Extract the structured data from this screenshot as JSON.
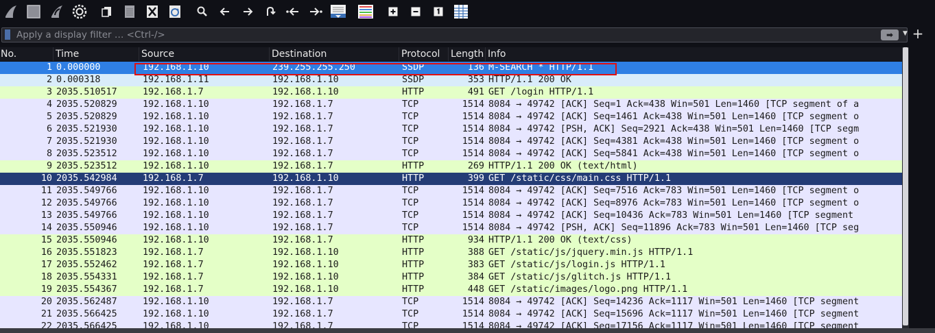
{
  "toolbar": {
    "icons": [
      "shark-fin-start-icon",
      "stop-capture-icon",
      "shark-fin-restart-icon",
      "capture-options-gear-icon",
      "open-file-icon",
      "save-file-icon",
      "close-file-icon",
      "reload-file-icon",
      "find-packet-icon",
      "go-back-icon",
      "go-forward-icon",
      "go-to-packet-icon",
      "first-packet-icon",
      "last-packet-icon",
      "auto-scroll-icon",
      "colorize-icon",
      "zoom-in-icon",
      "zoom-out-icon",
      "normal-size-icon",
      "resize-columns-icon"
    ]
  },
  "filter": {
    "placeholder": "Apply a display filter … <Ctrl-/>",
    "apply_glyph": "➡",
    "dropdown_glyph": "▼",
    "add_glyph": "+"
  },
  "columns": [
    "No.",
    "Time",
    "Source",
    "Destination",
    "Protocol",
    "Length",
    "Info"
  ],
  "colors": {
    "udp": "#d9ecfa",
    "http": "#e4ffc7",
    "tcp": "#e7e6ff",
    "selected": "#2f7fe4",
    "selected_dark": "#243c76",
    "highlight_box": "#e01010"
  },
  "packets": [
    {
      "no": "1",
      "time": "0.000000",
      "src": "192.168.1.10",
      "dst": "239.255.255.250",
      "proto": "SSDP",
      "len": "136",
      "info": "M-SEARCH * HTTP/1.1",
      "style": "selected"
    },
    {
      "no": "2",
      "time": "0.000318",
      "src": "192.168.1.11",
      "dst": "192.168.1.10",
      "proto": "SSDP",
      "len": "353",
      "info": "HTTP/1.1 200 OK",
      "style": "udp"
    },
    {
      "no": "3",
      "time": "2035.510517",
      "src": "192.168.1.7",
      "dst": "192.168.1.10",
      "proto": "HTTP",
      "len": "491",
      "info": "GET /login HTTP/1.1",
      "style": "http"
    },
    {
      "no": "4",
      "time": "2035.520829",
      "src": "192.168.1.10",
      "dst": "192.168.1.7",
      "proto": "TCP",
      "len": "1514",
      "info": "8084 → 49742 [ACK] Seq=1 Ack=438 Win=501 Len=1460 [TCP segment of a",
      "style": "tcp"
    },
    {
      "no": "5",
      "time": "2035.520829",
      "src": "192.168.1.10",
      "dst": "192.168.1.7",
      "proto": "TCP",
      "len": "1514",
      "info": "8084 → 49742 [ACK] Seq=1461 Ack=438 Win=501 Len=1460 [TCP segment o",
      "style": "tcp"
    },
    {
      "no": "6",
      "time": "2035.521930",
      "src": "192.168.1.10",
      "dst": "192.168.1.7",
      "proto": "TCP",
      "len": "1514",
      "info": "8084 → 49742 [PSH, ACK] Seq=2921 Ack=438 Win=501 Len=1460 [TCP segm",
      "style": "tcp"
    },
    {
      "no": "7",
      "time": "2035.521930",
      "src": "192.168.1.10",
      "dst": "192.168.1.7",
      "proto": "TCP",
      "len": "1514",
      "info": "8084 → 49742 [ACK] Seq=4381 Ack=438 Win=501 Len=1460 [TCP segment o",
      "style": "tcp"
    },
    {
      "no": "8",
      "time": "2035.523512",
      "src": "192.168.1.10",
      "dst": "192.168.1.7",
      "proto": "TCP",
      "len": "1514",
      "info": "8084 → 49742 [ACK] Seq=5841 Ack=438 Win=501 Len=1460 [TCP segment o",
      "style": "tcp"
    },
    {
      "no": "9",
      "time": "2035.523512",
      "src": "192.168.1.10",
      "dst": "192.168.1.7",
      "proto": "HTTP",
      "len": "269",
      "info": "HTTP/1.1 200 OK  (text/html)",
      "style": "http"
    },
    {
      "no": "10",
      "time": "2035.542984",
      "src": "192.168.1.7",
      "dst": "192.168.1.10",
      "proto": "HTTP",
      "len": "399",
      "info": "GET /static/css/main.css HTTP/1.1",
      "style": "selected_dark"
    },
    {
      "no": "11",
      "time": "2035.549766",
      "src": "192.168.1.10",
      "dst": "192.168.1.7",
      "proto": "TCP",
      "len": "1514",
      "info": "8084 → 49742 [ACK] Seq=7516 Ack=783 Win=501 Len=1460 [TCP segment o",
      "style": "tcp"
    },
    {
      "no": "12",
      "time": "2035.549766",
      "src": "192.168.1.10",
      "dst": "192.168.1.7",
      "proto": "TCP",
      "len": "1514",
      "info": "8084 → 49742 [ACK] Seq=8976 Ack=783 Win=501 Len=1460 [TCP segment o",
      "style": "tcp"
    },
    {
      "no": "13",
      "time": "2035.549766",
      "src": "192.168.1.10",
      "dst": "192.168.1.7",
      "proto": "TCP",
      "len": "1514",
      "info": "8084 → 49742 [ACK] Seq=10436 Ack=783 Win=501 Len=1460 [TCP segment",
      "style": "tcp"
    },
    {
      "no": "14",
      "time": "2035.550946",
      "src": "192.168.1.10",
      "dst": "192.168.1.7",
      "proto": "TCP",
      "len": "1514",
      "info": "8084 → 49742 [PSH, ACK] Seq=11896 Ack=783 Win=501 Len=1460 [TCP seg",
      "style": "tcp"
    },
    {
      "no": "15",
      "time": "2035.550946",
      "src": "192.168.1.10",
      "dst": "192.168.1.7",
      "proto": "HTTP",
      "len": "934",
      "info": "HTTP/1.1 200 OK  (text/css)",
      "style": "http"
    },
    {
      "no": "16",
      "time": "2035.551823",
      "src": "192.168.1.7",
      "dst": "192.168.1.10",
      "proto": "HTTP",
      "len": "388",
      "info": "GET /static/js/jquery.min.js HTTP/1.1",
      "style": "http"
    },
    {
      "no": "17",
      "time": "2035.552462",
      "src": "192.168.1.7",
      "dst": "192.168.1.10",
      "proto": "HTTP",
      "len": "383",
      "info": "GET /static/js/login.js HTTP/1.1",
      "style": "http"
    },
    {
      "no": "18",
      "time": "2035.554331",
      "src": "192.168.1.7",
      "dst": "192.168.1.10",
      "proto": "HTTP",
      "len": "384",
      "info": "GET /static/js/glitch.js HTTP/1.1",
      "style": "http"
    },
    {
      "no": "19",
      "time": "2035.554367",
      "src": "192.168.1.7",
      "dst": "192.168.1.10",
      "proto": "HTTP",
      "len": "448",
      "info": "GET /static/images/logo.png HTTP/1.1",
      "style": "http"
    },
    {
      "no": "20",
      "time": "2035.562487",
      "src": "192.168.1.10",
      "dst": "192.168.1.7",
      "proto": "TCP",
      "len": "1514",
      "info": "8084 → 49742 [ACK] Seq=14236 Ack=1117 Win=501 Len=1460 [TCP segment",
      "style": "tcp"
    },
    {
      "no": "21",
      "time": "2035.566425",
      "src": "192.168.1.10",
      "dst": "192.168.1.7",
      "proto": "TCP",
      "len": "1514",
      "info": "8084 → 49742 [ACK] Seq=15696 Ack=1117 Win=501 Len=1460 [TCP segment",
      "style": "tcp"
    },
    {
      "no": "22",
      "time": "2035.566425",
      "src": "192.168.1.10",
      "dst": "192.168.1.7",
      "proto": "TCP",
      "len": "1514",
      "info": "8084 → 49742 [ACK] Seq=17156 Ack=1117 Win=501 Len=1460 [TCP segment",
      "style": "tcp"
    }
  ]
}
